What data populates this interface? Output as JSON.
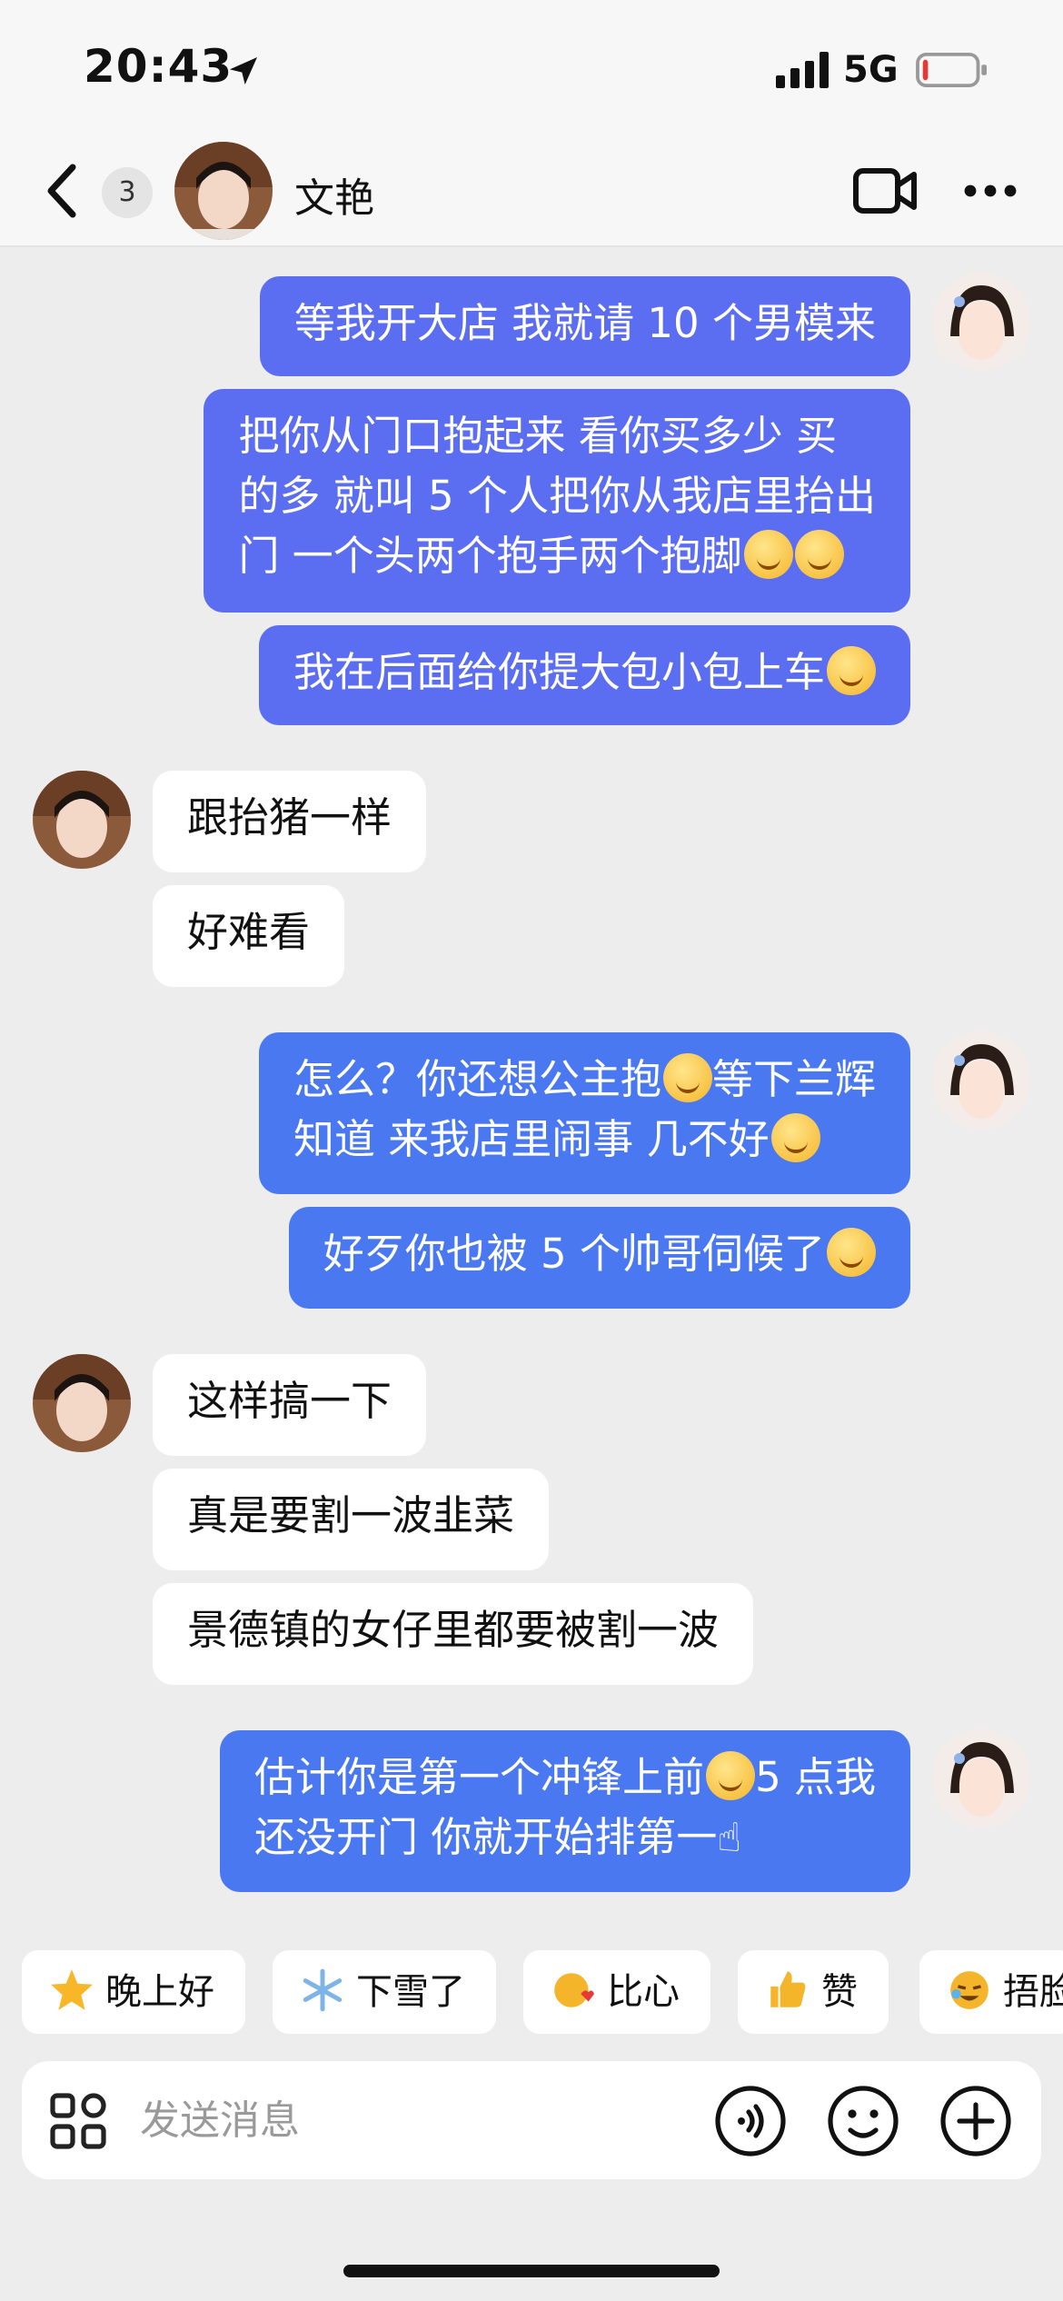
{
  "status_bar": {
    "time": "20:43",
    "network": "5G",
    "battery_level": 0.1
  },
  "header": {
    "back_icon": "chevron-left-icon",
    "unread_count": "3",
    "contact_name": "文艳",
    "video_icon": "video-camera-icon",
    "more_icon": "more-dots-icon"
  },
  "messages": [
    {
      "from": "me",
      "lines": [
        "等我开大店 我就请 10 个男模来"
      ],
      "emoji": 0
    },
    {
      "from": "me",
      "lines": [
        "把你从门口抱起来 看你买多少 买",
        "的多 就叫 5 个人把你从我店里抬出",
        "门 一个头两个抱手两个抱脚"
      ],
      "emoji": 2
    },
    {
      "from": "me",
      "lines": [
        "我在后面给你提大包小包上车"
      ],
      "emoji": 1
    },
    {
      "from": "them",
      "lines": [
        "跟抬猪一样"
      ]
    },
    {
      "from": "them",
      "lines": [
        "好难看"
      ]
    },
    {
      "from": "me",
      "lines": [
        "怎么？你还想公主抱",
        "等下兰辉",
        "知道 来我店里闹事 几不好"
      ],
      "emoji": 2
    },
    {
      "from": "me",
      "lines": [
        "好歹你也被 5 个帅哥伺候了"
      ],
      "emoji": 1
    },
    {
      "from": "them",
      "lines": [
        "这样搞一下"
      ]
    },
    {
      "from": "them",
      "lines": [
        "真是要割一波韭菜"
      ]
    },
    {
      "from": "them",
      "lines": [
        "景德镇的女仔里都要被割一波"
      ]
    },
    {
      "from": "me",
      "lines": [
        "估计你是第一个冲锋上前",
        "5 点我",
        "还没开门 你就开始排第一"
      ],
      "emoji": 2
    }
  ],
  "quick_replies": [
    {
      "label": "晚上好",
      "icon": "star-face-icon"
    },
    {
      "label": "下雪了",
      "icon": "snowflake-icon"
    },
    {
      "label": "比心",
      "icon": "heart-hand-icon"
    },
    {
      "label": "赞",
      "icon": "thumbs-up-icon"
    },
    {
      "label": "捂脸",
      "icon": "facepalm-icon"
    }
  ],
  "input": {
    "placeholder": "发送消息"
  },
  "colors": {
    "sent_bubble": "#5b6df0",
    "sent_bubble_alt": "#4a78f0",
    "received_bubble": "#ffffff",
    "background": "#ededed"
  }
}
